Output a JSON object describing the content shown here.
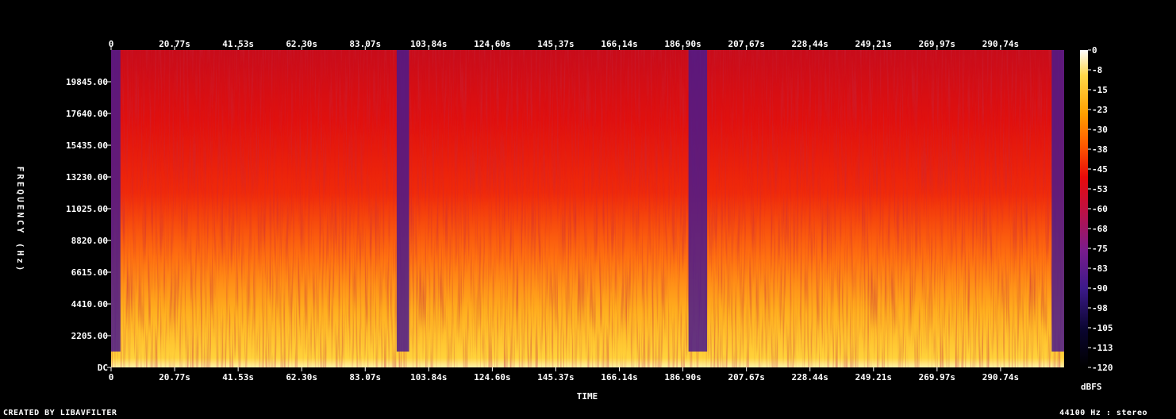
{
  "chart_data": {
    "type": "heatmap",
    "xlabel": "TIME",
    "ylabel": "FREQUENCY (Hz)",
    "x_ticks": [
      "0",
      "20.77s",
      "41.53s",
      "62.30s",
      "83.07s",
      "103.84s",
      "124.60s",
      "145.37s",
      "166.14s",
      "186.90s",
      "207.67s",
      "228.44s",
      "249.21s",
      "269.97s",
      "290.74s"
    ],
    "x_range": [
      0,
      307
    ],
    "y_ticks": [
      "DC",
      "2205.00",
      "4410.00",
      "6615.00",
      "8820.00",
      "11025.00",
      "13230.00",
      "15435.00",
      "17640.00",
      "19845.00"
    ],
    "y_range": [
      0,
      22050
    ],
    "colorbar": {
      "label": "dBFS",
      "ticks": [
        "0",
        "-8",
        "-15",
        "-23",
        "-30",
        "-38",
        "-45",
        "-53",
        "-60",
        "-68",
        "-75",
        "-83",
        "-90",
        "-98",
        "-105",
        "-113",
        "-120"
      ],
      "range": [
        -120,
        0
      ]
    },
    "quiet_sections_s": [
      [
        0,
        3
      ],
      [
        92,
        96
      ],
      [
        186,
        192
      ],
      [
        303,
        307
      ]
    ],
    "grid": false,
    "legend": "right"
  },
  "footer": {
    "credit": "CREATED BY LIBAVFILTER",
    "audio_info": "44100 Hz : stereo"
  },
  "colors": {
    "background": "#000000",
    "text": "#ffffff",
    "palette": [
      "#000000",
      "#0a0530",
      "#3c1a8a",
      "#7a1c8c",
      "#c01040",
      "#e80a0a",
      "#ff5a00",
      "#ffa000",
      "#ffd84a",
      "#ffffff"
    ]
  }
}
